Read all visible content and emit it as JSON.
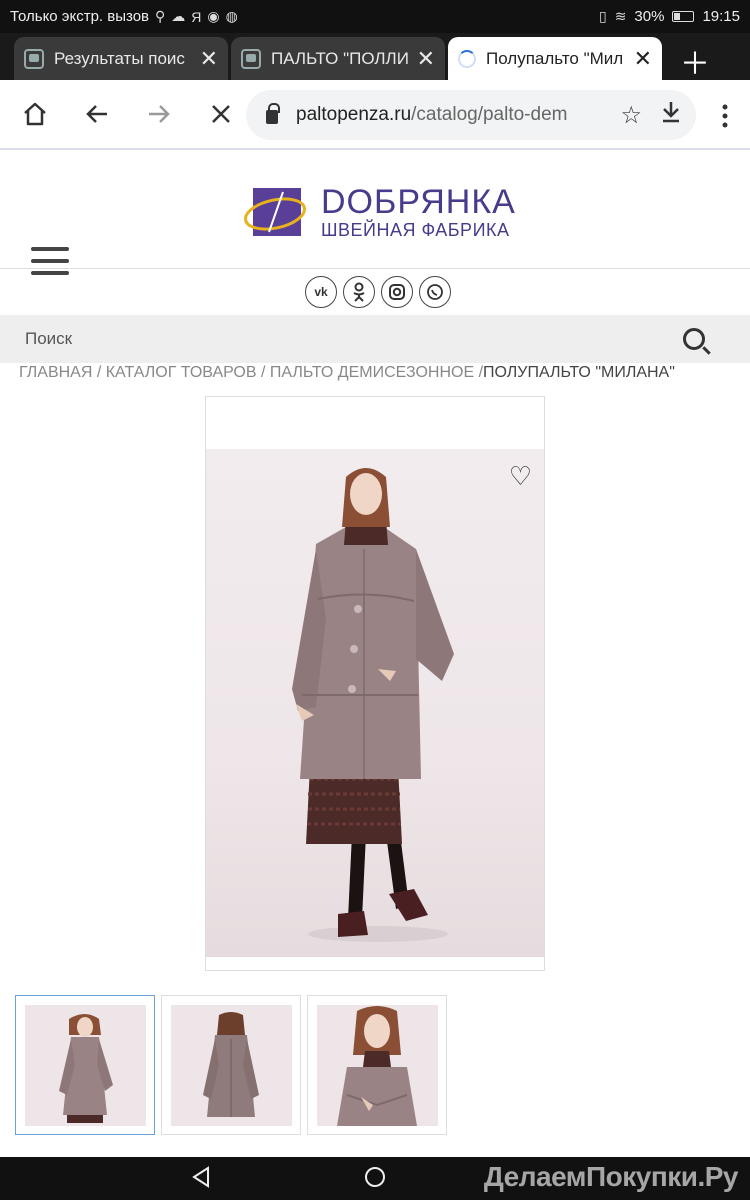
{
  "status_bar": {
    "carrier_text": "Только экстр. вызов",
    "battery": "30%",
    "battery_level": 0.3,
    "time": "19:15"
  },
  "tabs": [
    {
      "title": "Результаты поис",
      "active": false
    },
    {
      "title": "ПАЛЬТО \"ПОЛЛИ",
      "active": false
    },
    {
      "title": "Полупальто \"Мил",
      "active": true
    }
  ],
  "browser": {
    "url_domain": "paltopenza.ru",
    "url_path": "/catalog/palto-dem"
  },
  "site": {
    "brand_name": "DОБРЯНКА",
    "brand_sub": "ШВЕЙНАЯ ФАБРИКА",
    "socials": [
      "vk",
      "ok",
      "ig",
      "wa"
    ],
    "search_placeholder": "Поиск",
    "breadcrumbs": [
      "ГЛАВНАЯ",
      "КАТАЛОГ ТОВАРОВ",
      "ПАЛЬТО ДЕМИСЕЗОННОЕ",
      "ПОЛУПАЛЬТО \"МИЛАНА\""
    ]
  },
  "watermark": "ДелаемПокупки.Ру",
  "colors": {
    "brand": "#4a3a8c",
    "logo_gold": "#e8b21a",
    "coat": "#9a8385",
    "thumb_active_border": "#6aa0d8"
  }
}
